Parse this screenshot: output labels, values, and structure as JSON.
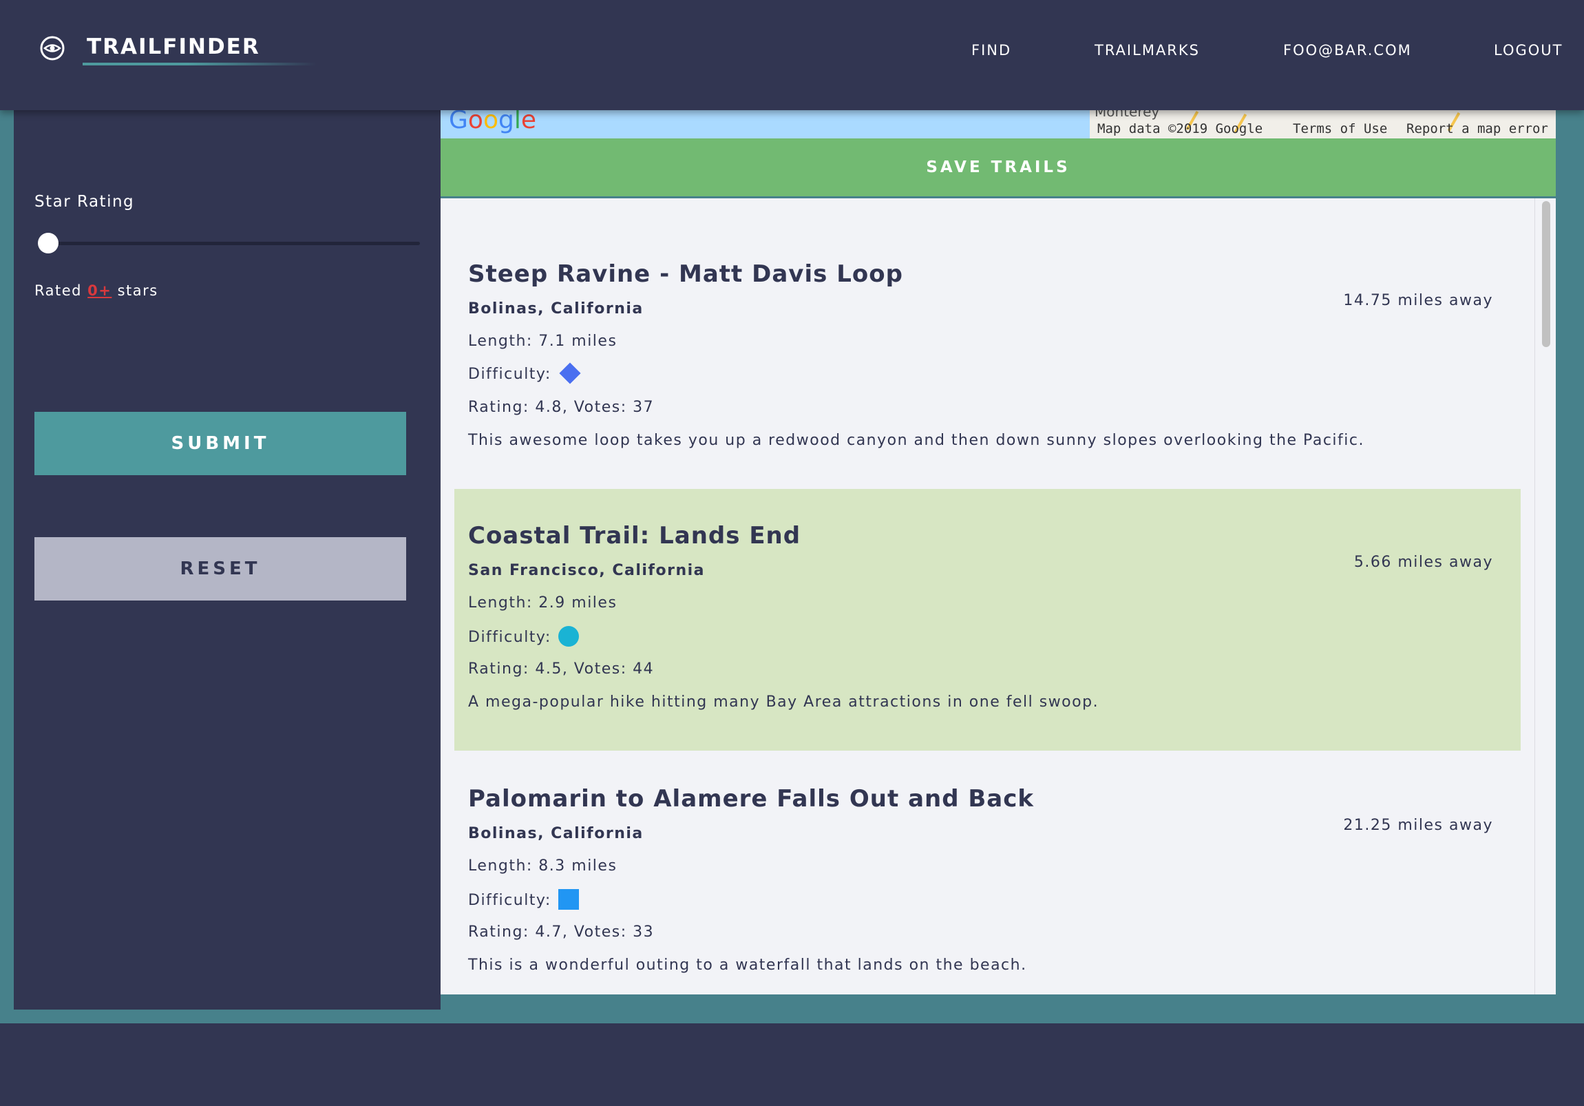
{
  "header": {
    "app_name": "TRAILFINDER",
    "nav": {
      "find": "FIND",
      "trailmarks": "TRAILMARKS",
      "user": "FOO@BAR.COM",
      "logout": "LOGOUT"
    }
  },
  "sidebar": {
    "star_rating_label": "Star Rating",
    "slider_value": 0,
    "rated_prefix": "Rated",
    "rated_value": "0+",
    "rated_suffix": "stars",
    "submit_label": "SUBMIT",
    "reset_label": "RESET"
  },
  "map": {
    "place_label": "Monterey",
    "attribution": "Map data ©2019 Google",
    "terms": "Terms of Use",
    "report": "Report a map error"
  },
  "save_trails_label": "SAVE TRAILS",
  "trails": [
    {
      "name": "Steep Ravine - Matt Davis Loop",
      "location": "Bolinas, California",
      "distance": "14.75 miles away",
      "length": "Length: 7.1 miles",
      "difficulty_label": "Difficulty:",
      "difficulty_icon": "blue-diamond-icon",
      "rating": "Rating: 4.8, Votes: 37",
      "description": "This awesome loop takes you up a redwood canyon and then down sunny slopes overlooking the Pacific.",
      "highlighted": false
    },
    {
      "name": "Coastal Trail: Lands End",
      "location": "San Francisco, California",
      "distance": "5.66 miles away",
      "length": "Length: 2.9 miles",
      "difficulty_label": "Difficulty:",
      "difficulty_icon": "teal-circle-icon",
      "rating": "Rating: 4.5, Votes: 44",
      "description": "A mega-popular hike hitting many Bay Area attractions in one fell swoop.",
      "highlighted": true
    },
    {
      "name": "Palomarin to Alamere Falls Out and Back",
      "location": "Bolinas, California",
      "distance": "21.25 miles away",
      "length": "Length: 8.3 miles",
      "difficulty_label": "Difficulty:",
      "difficulty_icon": "blue-square-icon",
      "rating": "Rating: 4.7, Votes: 33",
      "description": "This is a wonderful outing to a waterfall that lands on the beach.",
      "highlighted": false
    }
  ],
  "colors": {
    "navy": "#323652",
    "teal": "#4e9a9e",
    "frame_teal": "#47818b",
    "save_green": "#72ba72",
    "highlight_green": "#d7e6c3",
    "reset_gray": "#b4b6c6",
    "rated_red": "#d9393d",
    "difficulty_blue_diamond": "#4a6ff0",
    "difficulty_teal_circle": "#1ab3d4",
    "difficulty_blue_square": "#2196f3"
  }
}
